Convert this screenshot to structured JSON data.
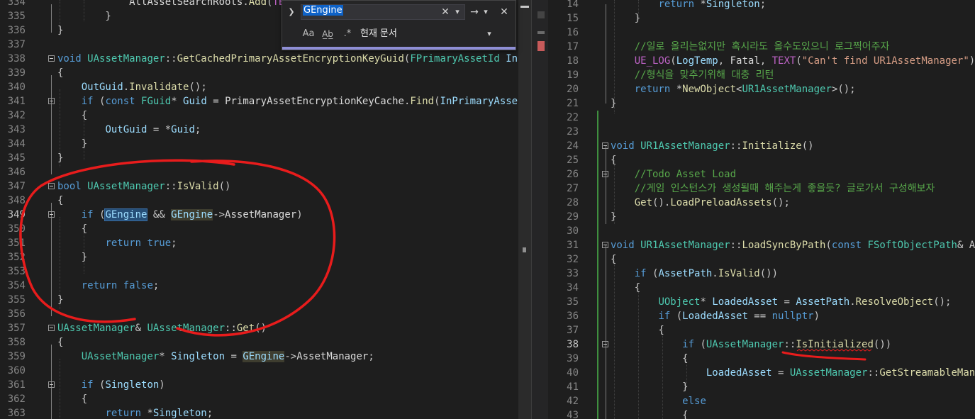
{
  "find": {
    "query": "GEngine",
    "scope_label": "현재 문서",
    "icons": [
      "chevron-down-icon",
      "clear-icon",
      "history-dropdown-icon",
      "find-next-icon",
      "find-dropdown-icon",
      "close-icon",
      "match-case-icon",
      "whole-word-icon",
      "regex-icon",
      "scope-dropdown-icon"
    ],
    "glyphs": {
      "toggle": "❯",
      "clear": "✕",
      "dropdown": "▾",
      "next": "→",
      "close": "✕",
      "case": "Aa",
      "word": "A̲b̲",
      "regex": ".*"
    }
  },
  "colors": {
    "keyword": "#569cd6",
    "type": "#4ec9b0",
    "function": "#dcdcaa",
    "string": "#d69d85",
    "comment": "#57a64a",
    "annotation": "#e81c1c"
  },
  "left_editor": {
    "lines": [
      {
        "n": "334",
        "segs": [
          {
            "t": "            ",
            "c": ""
          },
          {
            "t": "AllAssetSearchRoots",
            "c": "mv"
          },
          {
            "t": ".",
            "c": "p"
          },
          {
            "t": "Add",
            "c": "f"
          },
          {
            "t": "(",
            "c": "p"
          },
          {
            "t": "TEXT",
            "c": "m"
          },
          {
            "t": "(\"",
            "c": "p"
          }
        ]
      },
      {
        "n": "335",
        "segs": [
          {
            "t": "        }",
            "c": "p"
          }
        ]
      },
      {
        "n": "336",
        "segs": [
          {
            "t": "}",
            "c": "p"
          }
        ]
      },
      {
        "n": "337",
        "segs": []
      },
      {
        "n": "338",
        "fold": true,
        "segs": [
          {
            "t": "void ",
            "c": "k"
          },
          {
            "t": "UAssetManager",
            "c": "t"
          },
          {
            "t": "::",
            "c": "p"
          },
          {
            "t": "GetCachedPrimaryAssetEncryptionKeyGuid",
            "c": "f"
          },
          {
            "t": "(",
            "c": "p"
          },
          {
            "t": "FPrimaryAssetId",
            "c": "t"
          },
          {
            "t": " In",
            "c": "v"
          }
        ]
      },
      {
        "n": "339",
        "segs": [
          {
            "t": "{",
            "c": "p"
          }
        ]
      },
      {
        "n": "340",
        "segs": [
          {
            "t": "    ",
            "c": ""
          },
          {
            "t": "OutGuid",
            "c": "v"
          },
          {
            "t": ".",
            "c": "p"
          },
          {
            "t": "Invalidate",
            "c": "f"
          },
          {
            "t": "();",
            "c": "p"
          }
        ]
      },
      {
        "n": "341",
        "fold": true,
        "segs": [
          {
            "t": "    ",
            "c": ""
          },
          {
            "t": "if",
            "c": "k"
          },
          {
            "t": " (",
            "c": "p"
          },
          {
            "t": "const",
            "c": "k"
          },
          {
            "t": " ",
            "c": ""
          },
          {
            "t": "FGuid",
            "c": "t"
          },
          {
            "t": "* ",
            "c": "p"
          },
          {
            "t": "Guid",
            "c": "v"
          },
          {
            "t": " = ",
            "c": "p"
          },
          {
            "t": "PrimaryAssetEncryptionKeyCache",
            "c": "mv"
          },
          {
            "t": ".",
            "c": "p"
          },
          {
            "t": "Find",
            "c": "f"
          },
          {
            "t": "(",
            "c": "p"
          },
          {
            "t": "InPrimaryAsse",
            "c": "v"
          }
        ]
      },
      {
        "n": "342",
        "segs": [
          {
            "t": "    {",
            "c": "p"
          }
        ]
      },
      {
        "n": "343",
        "segs": [
          {
            "t": "        ",
            "c": ""
          },
          {
            "t": "OutGuid",
            "c": "v"
          },
          {
            "t": " = *",
            "c": "p"
          },
          {
            "t": "Guid",
            "c": "v"
          },
          {
            "t": ";",
            "c": "p"
          }
        ]
      },
      {
        "n": "344",
        "segs": [
          {
            "t": "    }",
            "c": "p"
          }
        ]
      },
      {
        "n": "345",
        "segs": [
          {
            "t": "}",
            "c": "p"
          }
        ]
      },
      {
        "n": "346",
        "segs": []
      },
      {
        "n": "347",
        "fold": true,
        "segs": [
          {
            "t": "bool ",
            "c": "k"
          },
          {
            "t": "UAssetManager",
            "c": "t"
          },
          {
            "t": "::",
            "c": "p"
          },
          {
            "t": "IsValid",
            "c": "f"
          },
          {
            "t": "()",
            "c": "p"
          }
        ]
      },
      {
        "n": "348",
        "segs": [
          {
            "t": "{",
            "c": "p"
          }
        ]
      },
      {
        "n": "349",
        "fold": true,
        "current": true,
        "segs": [
          {
            "t": "    ",
            "c": ""
          },
          {
            "t": "if",
            "c": "k"
          },
          {
            "t": " (",
            "c": "p"
          },
          {
            "t": "GEngine",
            "c": "v hl"
          },
          {
            "t": " && ",
            "c": "p"
          },
          {
            "t": "GEngine",
            "c": "v hl2"
          },
          {
            "t": "->",
            "c": "p"
          },
          {
            "t": "AssetManager",
            "c": "mv"
          },
          {
            "t": ")",
            "c": "p"
          }
        ]
      },
      {
        "n": "350",
        "segs": [
          {
            "t": "    {",
            "c": "p"
          }
        ]
      },
      {
        "n": "351",
        "segs": [
          {
            "t": "        ",
            "c": ""
          },
          {
            "t": "return",
            "c": "k"
          },
          {
            "t": " ",
            "c": ""
          },
          {
            "t": "true",
            "c": "k"
          },
          {
            "t": ";",
            "c": "p"
          }
        ]
      },
      {
        "n": "352",
        "segs": [
          {
            "t": "    }",
            "c": "p"
          }
        ]
      },
      {
        "n": "353",
        "segs": []
      },
      {
        "n": "354",
        "segs": [
          {
            "t": "    ",
            "c": ""
          },
          {
            "t": "return",
            "c": "k"
          },
          {
            "t": " ",
            "c": ""
          },
          {
            "t": "false",
            "c": "k"
          },
          {
            "t": ";",
            "c": "p"
          }
        ]
      },
      {
        "n": "355",
        "segs": [
          {
            "t": "}",
            "c": "p"
          }
        ]
      },
      {
        "n": "356",
        "segs": []
      },
      {
        "n": "357",
        "fold": true,
        "segs": [
          {
            "t": "UAssetManager",
            "c": "t"
          },
          {
            "t": "& ",
            "c": "p"
          },
          {
            "t": "UAssetManager",
            "c": "t"
          },
          {
            "t": "::",
            "c": "p"
          },
          {
            "t": "Get",
            "c": "f"
          },
          {
            "t": "()",
            "c": "p"
          }
        ]
      },
      {
        "n": "358",
        "segs": [
          {
            "t": "{",
            "c": "p"
          }
        ]
      },
      {
        "n": "359",
        "segs": [
          {
            "t": "    ",
            "c": ""
          },
          {
            "t": "UAssetManager",
            "c": "t"
          },
          {
            "t": "* ",
            "c": "p"
          },
          {
            "t": "Singleton",
            "c": "v"
          },
          {
            "t": " = ",
            "c": "p"
          },
          {
            "t": "GEngine",
            "c": "v hl2"
          },
          {
            "t": "->",
            "c": "p"
          },
          {
            "t": "AssetManager",
            "c": "mv"
          },
          {
            "t": ";",
            "c": "p"
          }
        ]
      },
      {
        "n": "360",
        "segs": []
      },
      {
        "n": "361",
        "fold": true,
        "segs": [
          {
            "t": "    ",
            "c": ""
          },
          {
            "t": "if",
            "c": "k"
          },
          {
            "t": " (",
            "c": "p"
          },
          {
            "t": "Singleton",
            "c": "v"
          },
          {
            "t": ")",
            "c": "p"
          }
        ]
      },
      {
        "n": "362",
        "segs": [
          {
            "t": "    {",
            "c": "p"
          }
        ]
      },
      {
        "n": "363",
        "segs": [
          {
            "t": "        ",
            "c": ""
          },
          {
            "t": "return",
            "c": "k"
          },
          {
            "t": " *",
            "c": "p"
          },
          {
            "t": "Singleton",
            "c": "v"
          },
          {
            "t": ";",
            "c": "p"
          }
        ]
      }
    ]
  },
  "right_editor": {
    "lines": [
      {
        "n": "14",
        "segs": [
          {
            "t": "        ",
            "c": ""
          },
          {
            "t": "return",
            "c": "k"
          },
          {
            "t": " *",
            "c": "p"
          },
          {
            "t": "Singleton",
            "c": "v"
          },
          {
            "t": ";",
            "c": "p"
          }
        ]
      },
      {
        "n": "15",
        "segs": [
          {
            "t": "    }",
            "c": "p"
          }
        ]
      },
      {
        "n": "16",
        "segs": []
      },
      {
        "n": "17",
        "segs": [
          {
            "t": "    ",
            "c": ""
          },
          {
            "t": "//일로 올리는없지만 혹시라도 올수도있으니 로그찍어주자",
            "c": "c"
          }
        ]
      },
      {
        "n": "18",
        "segs": [
          {
            "t": "    ",
            "c": ""
          },
          {
            "t": "UE_LOG",
            "c": "m"
          },
          {
            "t": "(",
            "c": "p"
          },
          {
            "t": "LogTemp",
            "c": "v"
          },
          {
            "t": ", ",
            "c": "p"
          },
          {
            "t": "Fatal",
            "c": "mv"
          },
          {
            "t": ", ",
            "c": "p"
          },
          {
            "t": "TEXT",
            "c": "m"
          },
          {
            "t": "(",
            "c": "p"
          },
          {
            "t": "\"Can't find UR1AssetManager\"",
            "c": "s"
          },
          {
            "t": ")",
            "c": "p"
          }
        ]
      },
      {
        "n": "19",
        "segs": [
          {
            "t": "    ",
            "c": ""
          },
          {
            "t": "//형식을 맞추기위해 대충 리턴",
            "c": "c"
          }
        ]
      },
      {
        "n": "20",
        "segs": [
          {
            "t": "    ",
            "c": ""
          },
          {
            "t": "return",
            "c": "k"
          },
          {
            "t": " *",
            "c": "p"
          },
          {
            "t": "NewObject",
            "c": "f"
          },
          {
            "t": "<",
            "c": "p"
          },
          {
            "t": "UR1AssetManager",
            "c": "t"
          },
          {
            "t": ">();",
            "c": "p"
          }
        ]
      },
      {
        "n": "21",
        "segs": [
          {
            "t": "}",
            "c": "p"
          }
        ]
      },
      {
        "n": "22",
        "segs": []
      },
      {
        "n": "23",
        "segs": []
      },
      {
        "n": "24",
        "fold": true,
        "segs": [
          {
            "t": "void ",
            "c": "k"
          },
          {
            "t": "UR1AssetManager",
            "c": "t"
          },
          {
            "t": "::",
            "c": "p"
          },
          {
            "t": "Initialize",
            "c": "f"
          },
          {
            "t": "()",
            "c": "p"
          }
        ]
      },
      {
        "n": "25",
        "segs": [
          {
            "t": "{",
            "c": "p"
          }
        ]
      },
      {
        "n": "26",
        "fold": true,
        "segs": [
          {
            "t": "    ",
            "c": ""
          },
          {
            "t": "//Todo Asset Load",
            "c": "c"
          }
        ]
      },
      {
        "n": "27",
        "segs": [
          {
            "t": "    ",
            "c": ""
          },
          {
            "t": "//게임 인스턴스가 생성될때 해주는게 좋을듯? 글로가서 구성해보자",
            "c": "c"
          }
        ]
      },
      {
        "n": "28",
        "segs": [
          {
            "t": "    ",
            "c": ""
          },
          {
            "t": "Get",
            "c": "f"
          },
          {
            "t": "().",
            "c": "p"
          },
          {
            "t": "LoadPreloadAssets",
            "c": "f"
          },
          {
            "t": "();",
            "c": "p"
          }
        ]
      },
      {
        "n": "29",
        "segs": [
          {
            "t": "}",
            "c": "p"
          }
        ]
      },
      {
        "n": "30",
        "segs": []
      },
      {
        "n": "31",
        "fold": true,
        "segs": [
          {
            "t": "void ",
            "c": "k"
          },
          {
            "t": "UR1AssetManager",
            "c": "t"
          },
          {
            "t": "::",
            "c": "p"
          },
          {
            "t": "LoadSyncByPath",
            "c": "f"
          },
          {
            "t": "(",
            "c": "p"
          },
          {
            "t": "const",
            "c": "k"
          },
          {
            "t": " ",
            "c": ""
          },
          {
            "t": "FSoftObjectPath",
            "c": "t"
          },
          {
            "t": "& A",
            "c": "p"
          }
        ]
      },
      {
        "n": "32",
        "segs": [
          {
            "t": "{",
            "c": "p"
          }
        ]
      },
      {
        "n": "33",
        "segs": [
          {
            "t": "    ",
            "c": ""
          },
          {
            "t": "if",
            "c": "k"
          },
          {
            "t": " (",
            "c": "p"
          },
          {
            "t": "AssetPath",
            "c": "v"
          },
          {
            "t": ".",
            "c": "p"
          },
          {
            "t": "IsValid",
            "c": "f"
          },
          {
            "t": "())",
            "c": "p"
          }
        ]
      },
      {
        "n": "34",
        "segs": [
          {
            "t": "    {",
            "c": "p"
          }
        ]
      },
      {
        "n": "35",
        "segs": [
          {
            "t": "        ",
            "c": ""
          },
          {
            "t": "UObject",
            "c": "t"
          },
          {
            "t": "* ",
            "c": "p"
          },
          {
            "t": "LoadedAsset",
            "c": "v"
          },
          {
            "t": " = ",
            "c": "p"
          },
          {
            "t": "AssetPath",
            "c": "v"
          },
          {
            "t": ".",
            "c": "p"
          },
          {
            "t": "ResolveObject",
            "c": "f"
          },
          {
            "t": "();",
            "c": "p"
          }
        ]
      },
      {
        "n": "36",
        "segs": [
          {
            "t": "        ",
            "c": ""
          },
          {
            "t": "if",
            "c": "k"
          },
          {
            "t": " (",
            "c": "p"
          },
          {
            "t": "LoadedAsset",
            "c": "v"
          },
          {
            "t": " == ",
            "c": "p"
          },
          {
            "t": "nullptr",
            "c": "k"
          },
          {
            "t": ")",
            "c": "p"
          }
        ]
      },
      {
        "n": "37",
        "segs": [
          {
            "t": "        {",
            "c": "p"
          }
        ]
      },
      {
        "n": "38",
        "fold": true,
        "current": true,
        "segs": [
          {
            "t": "            ",
            "c": ""
          },
          {
            "t": "if",
            "c": "k"
          },
          {
            "t": " (",
            "c": "p"
          },
          {
            "t": "UAssetManager",
            "c": "t"
          },
          {
            "t": "::",
            "c": "p"
          },
          {
            "t": "IsInitialized",
            "c": "f"
          },
          {
            "t": "())",
            "c": "p"
          }
        ]
      },
      {
        "n": "39",
        "segs": [
          {
            "t": "            {",
            "c": "p"
          }
        ]
      },
      {
        "n": "40",
        "segs": [
          {
            "t": "                ",
            "c": ""
          },
          {
            "t": "LoadedAsset",
            "c": "v"
          },
          {
            "t": " = ",
            "c": "p"
          },
          {
            "t": "UAssetManager",
            "c": "t"
          },
          {
            "t": "::",
            "c": "p"
          },
          {
            "t": "GetStreamableMan",
            "c": "f"
          }
        ]
      },
      {
        "n": "41",
        "segs": [
          {
            "t": "            }",
            "c": "p"
          }
        ]
      },
      {
        "n": "42",
        "segs": [
          {
            "t": "            ",
            "c": ""
          },
          {
            "t": "else",
            "c": "k"
          }
        ]
      },
      {
        "n": "43",
        "segs": [
          {
            "t": "            {",
            "c": "p"
          }
        ]
      }
    ]
  }
}
